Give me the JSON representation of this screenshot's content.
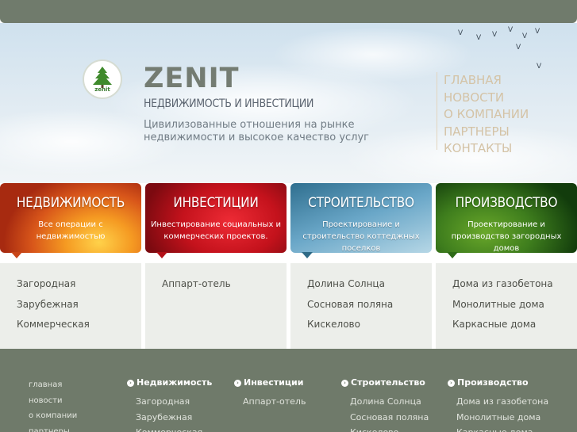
{
  "brand": {
    "name": "ZENIT",
    "logo_text": "zenit",
    "tagline": "НЕДВИЖИМОСТЬ И ИНВЕСТИЦИИ",
    "slogan": "Цивилизованные отношения на рынке недвижимости и высокое качество услуг"
  },
  "top_nav": [
    {
      "label": "ГЛАВНАЯ"
    },
    {
      "label": "НОВОСТИ"
    },
    {
      "label": "О КОМПАНИИ"
    },
    {
      "label": "ПАРТНЕРЫ"
    },
    {
      "label": "КОНТАКТЫ"
    }
  ],
  "cards": [
    {
      "title": "НЕДВИЖИМОСТЬ",
      "desc": "Все операции с недвижимостью",
      "items": [
        "Загородная",
        "Зарубежная",
        "Коммерческая"
      ]
    },
    {
      "title": "ИНВЕСТИЦИИ",
      "desc": "Инвестирование социальных и коммерческих проектов.",
      "items": [
        "Аппарт-отель"
      ]
    },
    {
      "title": "СТРОИТЕЛЬСТВО",
      "desc": "Проектирование и строительство коттеджных поселков",
      "items": [
        "Долина Солнца",
        "Сосновая поляна",
        "Кискелово"
      ]
    },
    {
      "title": "ПРОИЗВОДСТВО",
      "desc": "Проектирование и производство загородных домов",
      "items": [
        "Дома из газобетона",
        "Монолитные дома",
        "Каркасные дома"
      ]
    }
  ],
  "footer": {
    "main_links": [
      "главная",
      "новости",
      "о компании",
      "партнеры"
    ],
    "columns": [
      {
        "heading": "Недвижимость",
        "items": [
          "Загородная",
          "Зарубежная",
          "Коммерческая"
        ]
      },
      {
        "heading": "Инвестиции",
        "items": [
          "Аппарт-отель"
        ]
      },
      {
        "heading": "Строительство",
        "items": [
          "Долина Солнца",
          "Сосновая поляна",
          "Кискелово"
        ]
      },
      {
        "heading": "Производство",
        "items": [
          "Дома из газобетона",
          "Монолитные дома",
          "Каркасные дома"
        ]
      }
    ]
  },
  "colors": {
    "header_bar": "#707b6c",
    "nav_text": "#d4c3a6",
    "footer_bg": "#6f7a6a",
    "card_body_bg": "#eceeea"
  }
}
